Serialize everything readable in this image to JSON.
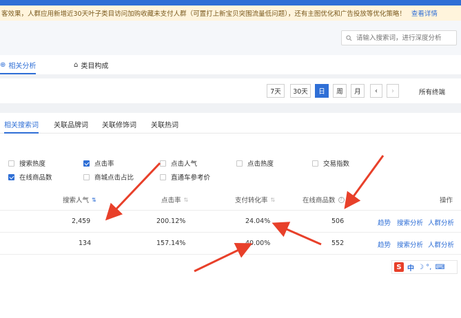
{
  "notice": {
    "text": "客效果，人群应用新增近30天叶子类目访问加购收藏未支付人群（可置打上新宝贝突围流量低问题），还有主图优化和广告投放等优化策略！",
    "link": "查看详情"
  },
  "search": {
    "placeholder": "请输入搜索词，进行深度分析"
  },
  "sub_tabs": [
    {
      "label": "相关分析",
      "active": true
    },
    {
      "label": "类目构成",
      "active": false
    }
  ],
  "date_range": {
    "buttons": [
      "7天",
      "30天",
      "日",
      "周",
      "月"
    ],
    "selected": "日",
    "prev": "‹",
    "next": "›",
    "terminal": "所有终端"
  },
  "assoc_tabs": [
    {
      "label": "相关搜索词",
      "active": true
    },
    {
      "label": "关联品牌词",
      "active": false
    },
    {
      "label": "关联修饰词",
      "active": false
    },
    {
      "label": "关联热词",
      "active": false
    }
  ],
  "filters": [
    {
      "label": "搜索热度",
      "checked": false
    },
    {
      "label": "点击率",
      "checked": true
    },
    {
      "label": "点击人气",
      "checked": false
    },
    {
      "label": "点击热度",
      "checked": false
    },
    {
      "label": "交易指数",
      "checked": false
    },
    {
      "label": "在线商品数",
      "checked": true
    },
    {
      "label": "商城点击占比",
      "checked": false
    },
    {
      "label": "直通车参考价",
      "checked": false
    }
  ],
  "table": {
    "columns": [
      "搜索人气",
      "点击率",
      "支付转化率",
      "在线商品数",
      "操作"
    ],
    "rows": [
      {
        "search_popularity": "2,459",
        "ctr": "200.12%",
        "conversion": "24.04%",
        "online_items": "506"
      },
      {
        "search_popularity": "134",
        "ctr": "157.14%",
        "conversion": "40.00%",
        "online_items": "552"
      }
    ],
    "actions": [
      "趋势",
      "搜索分析",
      "人群分析"
    ]
  },
  "ime": {
    "logo": "S",
    "mode": "中",
    "symbols": "☽ °,"
  },
  "colors": {
    "accent": "#2f6fd6",
    "arrow": "#e8402a",
    "notice_bg": "#fff4dc"
  }
}
